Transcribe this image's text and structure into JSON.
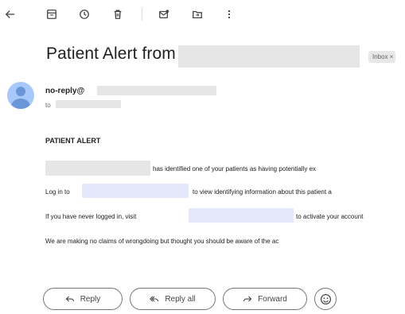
{
  "toolbar": {
    "icons": [
      "back-arrow-icon",
      "archive-icon",
      "snooze-icon",
      "delete-icon",
      "mark-unread-icon",
      "move-to-icon",
      "more-options-icon"
    ]
  },
  "email": {
    "subject": "Patient Alert from",
    "label_chip": "Inbox",
    "label_chip_close": "×",
    "sender_prefix": "no-reply@",
    "to_label": "to",
    "heading": "PATIENT ALERT",
    "line1": "has identified one of your patients as having potentially ex",
    "line2_prefix": "Log in to",
    "line2_suffix": "to view identifying information about this patient a",
    "line3_prefix": "If you have never logged in, visit",
    "line3_suffix": "to activate your account",
    "line4": "We are making no claims of wrongdoing but thought you should be aware of the ac"
  },
  "actions": {
    "reply": "Reply",
    "reply_all": "Reply all",
    "forward": "Forward"
  },
  "colors": {
    "avatar_bg": "#a8c7fa",
    "avatar_fg": "#6a96d8",
    "redacted_gray": "#e6e6e6",
    "redacted_link": "#e4e8fb"
  }
}
